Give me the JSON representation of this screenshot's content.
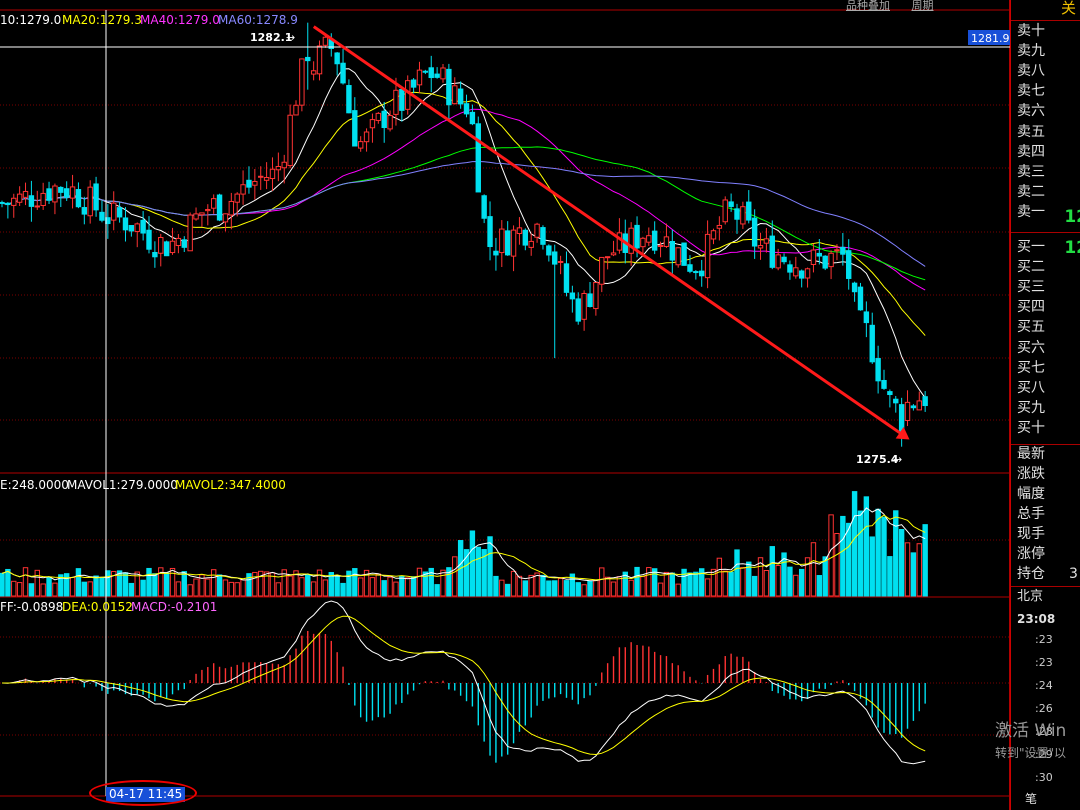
{
  "indicators": {
    "ma": "10:1279.0",
    "ma20": "MA20:1279.3",
    "ma40": "MA40:1279.0",
    "ma60": "MA60:1278.9",
    "vol": "E:248.0000",
    "mavol1": "MAVOL1:279.0000",
    "mavol2": "MAVOL2:347.4000",
    "diff": "FF:-0.0898",
    "dea": "DEA:0.0152",
    "macd": "MACD:-0.2101"
  },
  "annotations": {
    "high": "1282.1",
    "low": "1275.4",
    "price_tag": "1281.9",
    "cursor_time": "04-17 11:45"
  },
  "top_links": [
    "品种叠加",
    "周期"
  ],
  "side_panel": {
    "head": "关",
    "sell_labels": [
      "卖十",
      "卖九",
      "卖八",
      "卖七",
      "卖六",
      "卖五",
      "卖四",
      "卖三",
      "卖二",
      "卖一"
    ],
    "sell1_value": "12",
    "buy_labels": [
      "买一",
      "买二",
      "买三",
      "买四",
      "买五",
      "买六",
      "买七",
      "买八",
      "买九",
      "买十"
    ],
    "buy1_value": "12",
    "stats": [
      "最新",
      "涨跌",
      "幅度",
      "总手",
      "现手",
      "涨停",
      "持仓"
    ],
    "stat_value": "3",
    "city": "北京",
    "clock": "23:08",
    "times": [
      ":23",
      ":23",
      ":24",
      ":26",
      ":28",
      ":29",
      ":30"
    ],
    "bottom": "笔"
  },
  "watermark": {
    "line1": "激活 Win",
    "line2": "转到\"设置\"以"
  },
  "colors": {
    "up": "#ff3333",
    "down": "#00e0f0",
    "ma10": "#ffffff",
    "ma20": "#ffff00",
    "ma40": "#ff00ff",
    "ma60": "#00ff00",
    "ma120": "#8080ff",
    "trend": "#ff1a1a"
  },
  "chart_data": {
    "type": "candlestick",
    "price_ylim": [
      1275.0,
      1282.3
    ],
    "high": 1282.1,
    "low": 1275.4,
    "trend_line": {
      "from": 1282.1,
      "to": 1275.4
    }
  }
}
